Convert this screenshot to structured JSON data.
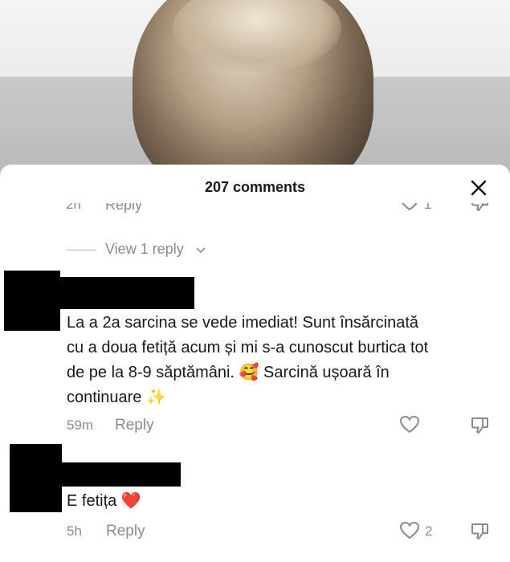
{
  "sheet": {
    "title": "207 comments"
  },
  "prev_comment": {
    "time": "2h",
    "reply_label": "Reply",
    "like_count": "1"
  },
  "view_replies": {
    "label": "View 1 reply"
  },
  "comments": [
    {
      "text": "La a 2a sarcina se vede imediat! Sunt însărcinată cu a doua fetiță acum și mi s-a cunoscut burtica tot de pe la 8-9 săptămâni. 🥰 Sarcină ușoară în continuare ✨",
      "lines": [
        "La a 2a sarcina se vede imediat! Sunt însărcinată",
        "cu a doua fetiță acum și mi s-a cunoscut burtica tot",
        "de pe la 8-9 săptămâni. 🥰 Sarcină ușoară în",
        "continuare ✨"
      ],
      "time": "59m",
      "reply_label": "Reply",
      "like_count": ""
    },
    {
      "text": "E fetița ❤️",
      "lines": [
        "E fetița ❤️"
      ],
      "time": "5h",
      "reply_label": "Reply",
      "like_count": "2"
    }
  ],
  "icons": {
    "close": "close-icon",
    "like": "heart-outline-icon",
    "dislike": "thumbs-down-icon",
    "expand": "chevron-down-icon"
  },
  "colors": {
    "muted": "#8a8b91",
    "text": "#161823",
    "redaction": "#000000"
  }
}
